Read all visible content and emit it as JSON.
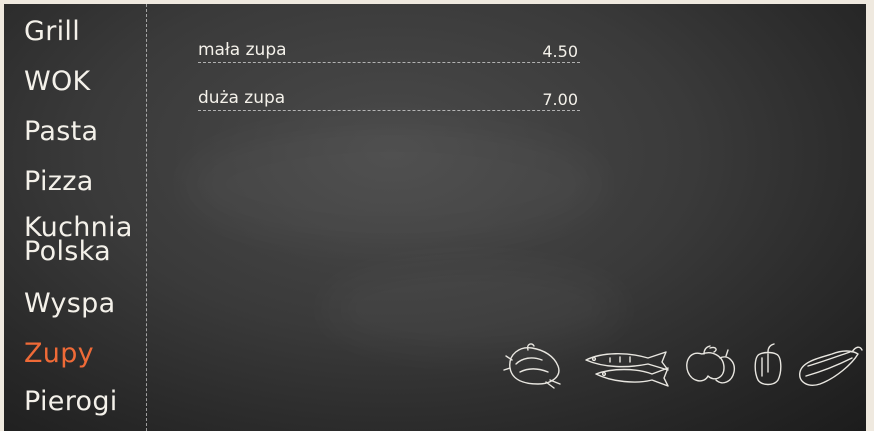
{
  "sidebar": {
    "items": [
      {
        "label": "Grill",
        "active": false
      },
      {
        "label": "WOK",
        "active": false
      },
      {
        "label": "Pasta",
        "active": false
      },
      {
        "label": "Pizza",
        "active": false
      },
      {
        "label": "Kuchnia",
        "label2": "Polska",
        "active": false
      },
      {
        "label": "Wyspa",
        "active": false
      },
      {
        "label": "Zupy",
        "active": true
      },
      {
        "label": "Pierogi",
        "active": false
      }
    ]
  },
  "menu": {
    "items": [
      {
        "name": "mała zupa",
        "price": "4.50"
      },
      {
        "name": "duża zupa",
        "price": "7.00"
      }
    ]
  },
  "colors": {
    "active": "#ef6a37",
    "text": "#f4f1ea",
    "board": "#3a3a3a"
  },
  "icons": [
    "chicken-icon",
    "fish-icon",
    "apples-icon",
    "pepper-icon",
    "eggplant-icon"
  ]
}
